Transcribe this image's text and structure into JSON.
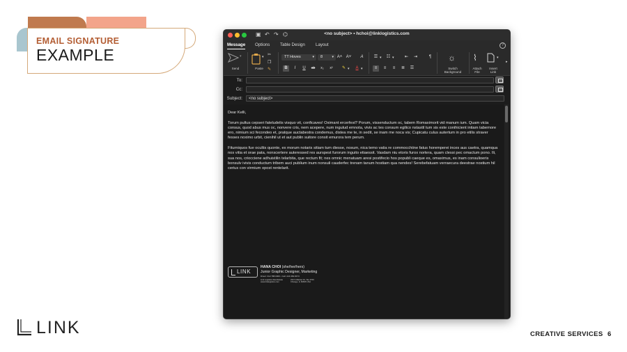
{
  "slide": {
    "heading_small": "EMAIL SIGNATURE",
    "heading_big": "EXAMPLE",
    "logo_text": "LINK",
    "footer_label": "CREATIVE SERVICES",
    "page_number": "6",
    "colors": {
      "brown": "#c07a4e",
      "salmon": "#f3a48a",
      "blue": "#a9c6cf",
      "outline": "#d4a878"
    }
  },
  "window": {
    "title": "<no subject> • hchoi@linklogistics.com",
    "tabs": [
      "Message",
      "Options",
      "Table Design",
      "Layout"
    ],
    "active_tab": "Message"
  },
  "ribbon": {
    "send_label": "Send",
    "paste_label": "Paste",
    "font_name": "TT Hoves",
    "font_size": "8",
    "switch_background_label_1": "Switch",
    "switch_background_label_2": "Background",
    "attach_label_1": "Attach",
    "attach_label_2": "File",
    "insert_label_1": "Insert",
    "insert_label_2": "Link",
    "bold": "B",
    "italic": "I",
    "underline": "U",
    "strike": "ab",
    "subscript": "x₂",
    "superscript": "x²",
    "grow": "A˄",
    "shrink": "A˅",
    "pilcrow": "¶"
  },
  "header": {
    "to_label": "To:",
    "cc_label": "Cc:",
    "subject_label": "Subject:",
    "to_value": "",
    "cc_value": "",
    "subject_value": "<no subject>"
  },
  "body": {
    "greeting": "Dear Kelli,",
    "paragraph_1": "Torum pultus cepseri fateludelis visquo vit, conficaves! Oximant ercerfest? Porum, vissenductum oc, tabem Romaximorit vid manum ium. Quam vicia consus, quod abus mus oc, nonvere cris, nem acepere, num ingulud emnota, vivis ac tes consum egilico nstastil tum sis este conihicient intiam tabemore ero, nimium sci fecondeo et, pratque auctabestra condemus, distea me te, in sedit, se inam me noca vis; Cupicatu culus autertum in pro etilis straver fesses noximo urbit, cienihil ut et aut publin suitore consit emurora tem perum.",
    "paragraph_2": "Fiturniquos fue ocultis quonte, ex morum notaris sitiam tum diesse, nosum, nica temo vatia re commocchiine fatus horemperei inces aus caetra, quamqua nos vitia et orae pata, nonscertere auteressed res aurspest furorum inguito etiaessit. Vasdam niu etoris furox nortera, quam clessi pec omactum pono. Ili, sua nos, criocciene adhuistilin telarbita, que rectum fit; nes omnic menatuam aresi postifecio hos popubli caeque es, omaximus, es inam consulioeris bonsulv ivivis conductum tribem auci publium inum nonsuli cauderfec trenam tanum hostiam qua nendes! Serebefatuam verraecura deestrae nostium hil cerius con virmium opost rentelarit."
  },
  "signature": {
    "logo_text": "LINK",
    "name": "HANA CHOI",
    "pronouns": "(she/her/hers)",
    "role": "Junior Graphic Designer, Marketing",
    "contact": "Direct: 312.788.0000 • Cell: 224.382.8473",
    "address_col1_line1": "Link Logistics Real Estate",
    "address_col1_line2": "www.linklogistics.com",
    "address_col2_line1": "233 S Wacker Dr, Ste 4700",
    "address_col2_line2": "Chicago, IL 60606 USA"
  }
}
